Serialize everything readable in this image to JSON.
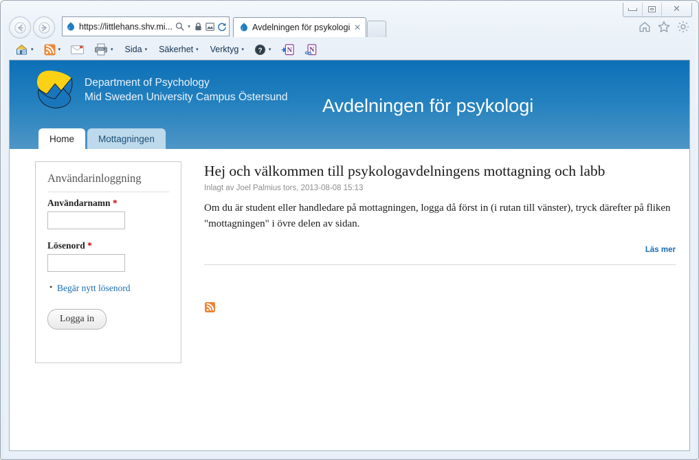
{
  "browser": {
    "window_controls": {
      "minimize": "minimize-button",
      "maximize": "maximize-button",
      "close": "close-button",
      "close_glyph": "✕"
    },
    "back_glyph": "←",
    "forward_glyph": "→",
    "address": {
      "url": "https://littlehans.shv.mi...",
      "search_icon": "search-icon",
      "lock_icon": "lock-icon",
      "compat_icon": "compatibility-view-icon",
      "refresh_icon": "refresh-icon",
      "refresh_glyph": "↻",
      "caret": "▾"
    },
    "tab": {
      "title": "Avdelningen för psykologi",
      "close_glyph": "✕"
    },
    "right_icons": [
      "home-icon",
      "favorites-icon",
      "settings-icon"
    ],
    "commandbar": {
      "home_label": "",
      "feeds_label": "",
      "mail_label": "",
      "print_label": "",
      "page_label": "Sida",
      "safety_label": "Säkerhet",
      "tools_label": "Verktyg",
      "help_label": "",
      "caret": "▾"
    }
  },
  "site": {
    "brand_line1": "Department of Psychology",
    "brand_line2": "Mid Sweden University Campus Östersund",
    "title": "Avdelningen för psykologi",
    "header_color_top": "#0d70b7",
    "header_color_bottom": "#4e96c6",
    "tabs": [
      {
        "label": "Home",
        "active": true
      },
      {
        "label": "Mottagningen",
        "active": false
      }
    ]
  },
  "login_block": {
    "title": "Användarinloggning",
    "username_label": "Användarnamn",
    "username_value": "",
    "password_label": "Lösenord",
    "password_value": "",
    "required_marker": "*",
    "request_password_link": "Begär nytt lösenord",
    "submit_label": "Logga in"
  },
  "article": {
    "title": "Hej och välkommen till psykologavdelningens mottagning och labb",
    "meta": "Inlagt av Joel Palmius tors, 2013-08-08 15:13",
    "body": "Om du är student eller handledare på mottagningen, logga då först in (i rutan till vänster), tryck därefter på fliken \"mottagningen\" i övre delen av sidan.",
    "read_more": "Läs mer",
    "feed_icon": "rss-feed-icon",
    "feed_color": "#ec8234"
  }
}
